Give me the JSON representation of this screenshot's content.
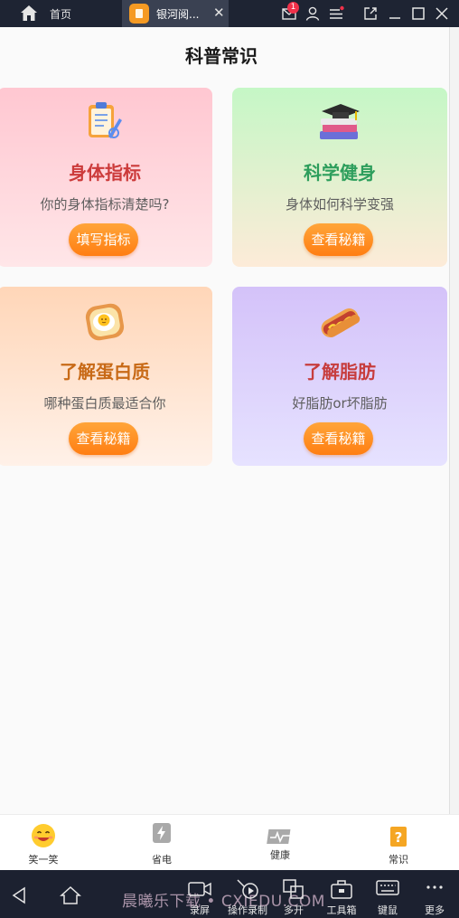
{
  "topbar": {
    "home_label": "首页",
    "app_tab_title": "银河阅...",
    "close_glyph": "✕",
    "mail_badge_count": "1",
    "icons": [
      "home-icon",
      "mail-icon",
      "user-icon",
      "menu-icon",
      "expand-icon",
      "minimize-icon",
      "maximize-icon",
      "close-icon"
    ]
  },
  "page": {
    "title": "科普常识"
  },
  "cards": [
    {
      "title": "身体指标",
      "subtitle": "你的身体指标清楚吗?",
      "button": "填写指标",
      "title_color": "#cc3b3b",
      "icon": "clipboard-icon"
    },
    {
      "title": "科学健身",
      "subtitle": "身体如何科学变强",
      "button": "查看秘籍",
      "title_color": "#2d9e5c",
      "icon": "books-icon"
    },
    {
      "title": "了解蛋白质",
      "subtitle": "哪种蛋白质最适合你",
      "button": "查看秘籍",
      "title_color": "#c86a17",
      "icon": "egg-toast-icon"
    },
    {
      "title": "了解脂肪",
      "subtitle": "好脂肪or坏脂肪",
      "button": "查看秘籍",
      "title_color": "#c73d3d",
      "icon": "hotdog-icon"
    }
  ],
  "tabbar": {
    "items": [
      {
        "label": "笑一笑",
        "icon": "smile-icon"
      },
      {
        "label": "省电",
        "icon": "battery-icon"
      },
      {
        "label": "健康",
        "icon": "pulse-icon"
      },
      {
        "label": "常识",
        "icon": "question-icon"
      }
    ]
  },
  "sysbar": {
    "items": [
      {
        "label": "录屏",
        "icon": "record-icon"
      },
      {
        "label": "操作录制",
        "icon": "macro-icon"
      },
      {
        "label": "多开",
        "icon": "multi-icon"
      },
      {
        "label": "工具箱",
        "icon": "toolbox-icon"
      },
      {
        "label": "键鼠",
        "icon": "keyboard-icon"
      },
      {
        "label": "更多",
        "icon": "more-icon"
      }
    ],
    "watermark": "晨曦乐下载 • CXIEDU.COM"
  },
  "colors": {
    "accent_orange": "#ff8a1f",
    "topbar_bg": "#1e2433",
    "badge_red": "#f0314a"
  }
}
